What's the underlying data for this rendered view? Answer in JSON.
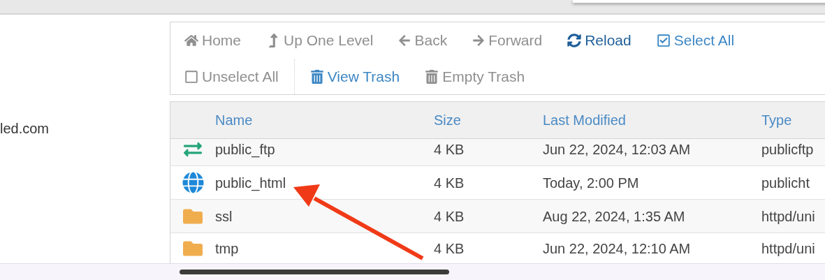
{
  "sidebar": {
    "domain": "led.com"
  },
  "toolbar": {
    "items": [
      {
        "label": "Home",
        "kind": "home",
        "disabled": true,
        "highlighted": false,
        "divider_before": false
      },
      {
        "label": "Up One Level",
        "kind": "up",
        "disabled": true,
        "highlighted": false,
        "divider_before": false
      },
      {
        "label": "Back",
        "kind": "back",
        "disabled": true,
        "highlighted": false,
        "divider_before": false
      },
      {
        "label": "Forward",
        "kind": "forward",
        "disabled": true,
        "highlighted": false,
        "divider_before": false
      },
      {
        "label": "Reload",
        "kind": "reload",
        "disabled": false,
        "highlighted": true,
        "divider_before": false
      },
      {
        "label": "Select All",
        "kind": "select",
        "disabled": false,
        "highlighted": false,
        "divider_before": false
      },
      {
        "label": "Unselect All",
        "kind": "unselect",
        "disabled": true,
        "highlighted": false,
        "divider_before": false
      },
      {
        "label": "View Trash",
        "kind": "trash",
        "disabled": false,
        "highlighted": false,
        "divider_before": true
      },
      {
        "label": "Empty Trash",
        "kind": "trash",
        "disabled": true,
        "highlighted": false,
        "divider_before": false
      }
    ]
  },
  "table": {
    "columns": [
      "Name",
      "Size",
      "Last Modified",
      "Type"
    ],
    "rows": [
      {
        "kind": "ftp",
        "name": "public_ftp",
        "size": "4 KB",
        "modified": "Jun 22, 2024, 12:03 AM",
        "type": "publicftp"
      },
      {
        "kind": "web",
        "name": "public_html",
        "size": "4 KB",
        "modified": "Today, 2:00 PM",
        "type": "publicht"
      },
      {
        "kind": "folder",
        "name": "ssl",
        "size": "4 KB",
        "modified": "Aug 22, 2024, 1:35 AM",
        "type": "httpd/uni"
      },
      {
        "kind": "folder",
        "name": "tmp",
        "size": "4 KB",
        "modified": "Jun 22, 2024, 12:10 AM",
        "type": "httpd/uni"
      }
    ]
  }
}
